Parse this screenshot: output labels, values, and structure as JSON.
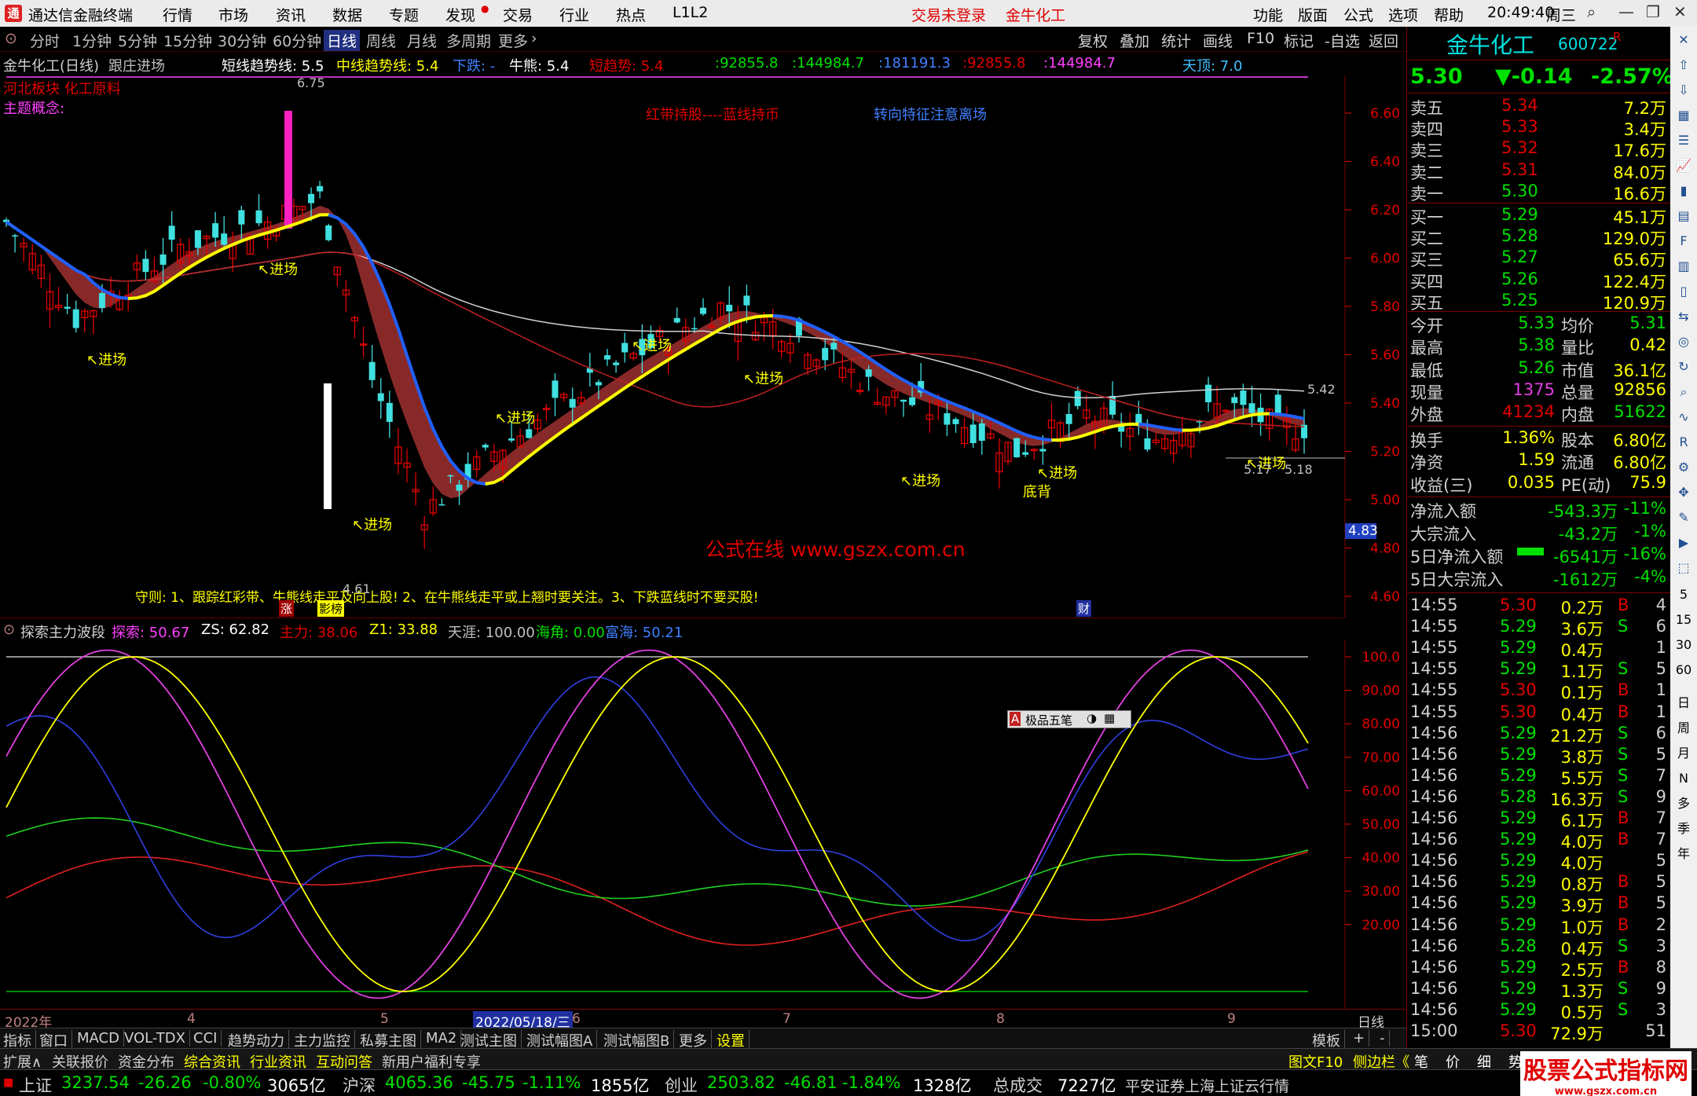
{
  "app": {
    "title": "通达信金融终端",
    "menus": [
      "行情",
      "市场",
      "资讯",
      "数据",
      "专题",
      "发现",
      "交易",
      "行业",
      "热点",
      "L1L2"
    ],
    "login_status": "交易未登录",
    "stock_title": "金牛化工",
    "right_menus": [
      "功能",
      "版面",
      "公式",
      "选项",
      "帮助"
    ],
    "clock": "20:49:40",
    "weekday": "周三"
  },
  "period_bar": {
    "periods": [
      "分时",
      "1分钟",
      "5分钟",
      "15分钟",
      "30分钟",
      "60分钟",
      "日线",
      "周线",
      "月线",
      "多周期",
      "更多"
    ],
    "selected": "日线",
    "right_buttons": [
      "复权",
      "叠加",
      "统计",
      "画线",
      "F10",
      "标记",
      "-自选",
      "返回"
    ]
  },
  "main_chart": {
    "header": {
      "name": "金牛化工(日线)",
      "indicator": "跟庄进场",
      "short_trend": "短线趋势线: 5.5",
      "mid_trend": "中线趋势线: 5.4",
      "down": "下跌: -",
      "bull": "牛熊: 5.4",
      "short_momentum": "短趋势: 5.4",
      "v1": ":92855.8",
      "v2": ":144984.7",
      "v3": ":181191.3",
      "v4": ":92855.8",
      "v5": ":144984.7",
      "top": "天顶: 7.0"
    },
    "concept_1": "河北板块 化工原料",
    "concept_2": "主题概念:",
    "note_red": "红带持股----蓝线持币",
    "note_blue": "转向特征注意离场",
    "watermark": "公式在线  www.gszx.com.cn",
    "rule": "守则: 1、跟踪红彩带、牛熊线走平及向上股! 2、在牛熊线走平或上翘时要关注。3、下跌蓝线时不要买股!",
    "high_label": "6.75",
    "low_label": "4.61",
    "labels": [
      "进场",
      "进场",
      "进场",
      "进场",
      "进场",
      "进场",
      "进场",
      "进场",
      "底背",
      "进场"
    ],
    "label_5_17": "5.17",
    "label_5_18": "5.18",
    "label_5_42": "5.42",
    "badge_zhang": "涨",
    "badge_yingbang": "影榜",
    "badge_cai": "财",
    "price_box": "4.83",
    "y_ticks": [
      "6.60",
      "6.40",
      "6.20",
      "6.00",
      "5.80",
      "5.60",
      "5.40",
      "5.20",
      "5.00",
      "4.80",
      "4.60"
    ]
  },
  "sub_chart": {
    "header": {
      "name": "探索主力波段",
      "explore": "探索: 50.67",
      "zs": "ZS: 62.82",
      "main": "主力: 38.06",
      "z1": "Z1: 33.88",
      "tianya": "天涯: 100.00",
      "haijiao": "海角: 0.00",
      "shanhai": "富海: 50.21"
    },
    "popup": "极品五笔",
    "y_ticks": [
      "100.0",
      "90.00",
      "80.00",
      "70.00",
      "60.00",
      "50.00",
      "40.00",
      "30.00",
      "20.00"
    ]
  },
  "date_axis": {
    "labels": [
      "2022年",
      "4",
      "5",
      "2022/05/18/三",
      "6",
      "7",
      "8",
      "9"
    ],
    "period": "日线"
  },
  "tabbar1": {
    "tabs": [
      "指标",
      "窗口",
      "MACD",
      "VOL-TDX",
      "CCI",
      "趋势动力",
      "主力监控",
      "私募主图",
      "MA2",
      "测试主图",
      "测试幅图A",
      "测试幅图B",
      "更多",
      "设置"
    ],
    "right": "模板",
    "plus": "+",
    "minus": "-"
  },
  "tabbar2": {
    "tabs": [
      "扩展∧",
      "关联报价",
      "资金分布",
      "综合资讯",
      "行业资讯",
      "互动问答",
      "新用户福利专享"
    ],
    "right": "图文F10",
    "right2": "侧边栏《",
    "quote_tabs": [
      "笔",
      "价",
      "细",
      "势"
    ]
  },
  "statusbar": {
    "sh_name": "上证",
    "sh_val": "3237.54",
    "sh_chg": "-26.26",
    "sh_pct": "-0.80%",
    "sh_amt": "3065亿",
    "hs_name": "沪深",
    "hs_val": "4065.36",
    "hs_chg": "-45.75",
    "hs_pct": "-1.11%",
    "hs_amt": "1855亿",
    "cy_name": "创业",
    "cy_val": "2503.82",
    "cy_chg": "-46.81",
    "cy_pct": "-1.84%",
    "cy_amt": "1328亿",
    "total_label": "总成交",
    "total_val": "7227亿",
    "broker": "平安证券上海上证云行情"
  },
  "quote": {
    "name": "金牛化工",
    "code": "600722",
    "flag": "R",
    "price": "5.30",
    "change": "▼-0.14",
    "pct": "-2.57%",
    "asks": [
      {
        "label": "卖五",
        "price": "5.34",
        "vol": "7.2万"
      },
      {
        "label": "卖四",
        "price": "5.33",
        "vol": "3.4万"
      },
      {
        "label": "卖三",
        "price": "5.32",
        "vol": "17.6万"
      },
      {
        "label": "卖二",
        "price": "5.31",
        "vol": "84.0万"
      },
      {
        "label": "卖一",
        "price": "5.30",
        "vol": "16.6万"
      }
    ],
    "bids": [
      {
        "label": "买一",
        "price": "5.29",
        "vol": "45.1万"
      },
      {
        "label": "买二",
        "price": "5.28",
        "vol": "129.0万"
      },
      {
        "label": "买三",
        "price": "5.27",
        "vol": "65.6万"
      },
      {
        "label": "买四",
        "price": "5.26",
        "vol": "122.4万"
      },
      {
        "label": "买五",
        "price": "5.25",
        "vol": "120.9万"
      }
    ],
    "stats": [
      {
        "l1": "今开",
        "v1": "5.33",
        "l2": "均价",
        "v2": "5.31"
      },
      {
        "l1": "最高",
        "v1": "5.38",
        "l2": "量比",
        "v2": "0.42"
      },
      {
        "l1": "最低",
        "v1": "5.26",
        "l2": "市值",
        "v2": "36.1亿"
      },
      {
        "l1": "现量",
        "v1": "1375",
        "l2": "总量",
        "v2": "92856"
      },
      {
        "l1": "外盘",
        "v1": "41234",
        "l2": "内盘",
        "v2": "51622"
      }
    ],
    "stats2": [
      {
        "l1": "换手",
        "v1": "1.36%",
        "l2": "股本",
        "v2": "6.80亿"
      },
      {
        "l1": "净资",
        "v1": "1.59",
        "l2": "流通",
        "v2": "6.80亿"
      },
      {
        "l1": "收益(三)",
        "v1": "0.035",
        "l2": "PE(动)",
        "v2": "75.9"
      }
    ],
    "flows": [
      {
        "label": "净流入额",
        "val": "-543.3万",
        "pct": "-11%"
      },
      {
        "label": "大宗流入",
        "val": "-43.2万",
        "pct": "-1%"
      },
      {
        "label": "5日净流入额",
        "val": "-6541万",
        "pct": "-16%"
      },
      {
        "label": "5日大宗流入",
        "val": "-1612万",
        "pct": "-4%"
      }
    ],
    "ticks": [
      {
        "t": "14:55",
        "p": "5.30",
        "v": "0.2万",
        "d": "B",
        "n": "4"
      },
      {
        "t": "14:55",
        "p": "5.29",
        "v": "3.6万",
        "d": "S",
        "n": "6"
      },
      {
        "t": "14:55",
        "p": "5.29",
        "v": "0.4万",
        "d": "",
        "n": "1"
      },
      {
        "t": "14:55",
        "p": "5.29",
        "v": "1.1万",
        "d": "S",
        "n": "5"
      },
      {
        "t": "14:55",
        "p": "5.30",
        "v": "0.1万",
        "d": "B",
        "n": "1"
      },
      {
        "t": "14:55",
        "p": "5.30",
        "v": "0.4万",
        "d": "B",
        "n": "1"
      },
      {
        "t": "14:56",
        "p": "5.29",
        "v": "21.2万",
        "d": "S",
        "n": "6"
      },
      {
        "t": "14:56",
        "p": "5.29",
        "v": "3.8万",
        "d": "S",
        "n": "5"
      },
      {
        "t": "14:56",
        "p": "5.29",
        "v": "5.5万",
        "d": "S",
        "n": "7"
      },
      {
        "t": "14:56",
        "p": "5.28",
        "v": "16.3万",
        "d": "S",
        "n": "9"
      },
      {
        "t": "14:56",
        "p": "5.29",
        "v": "6.1万",
        "d": "B",
        "n": "7"
      },
      {
        "t": "14:56",
        "p": "5.29",
        "v": "4.0万",
        "d": "B",
        "n": "7"
      },
      {
        "t": "14:56",
        "p": "5.29",
        "v": "4.0万",
        "d": "",
        "n": "5"
      },
      {
        "t": "14:56",
        "p": "5.29",
        "v": "0.8万",
        "d": "B",
        "n": "5"
      },
      {
        "t": "14:56",
        "p": "5.29",
        "v": "3.9万",
        "d": "B",
        "n": "5"
      },
      {
        "t": "14:56",
        "p": "5.29",
        "v": "1.0万",
        "d": "B",
        "n": "2"
      },
      {
        "t": "14:56",
        "p": "5.28",
        "v": "0.4万",
        "d": "S",
        "n": "3"
      },
      {
        "t": "14:56",
        "p": "5.29",
        "v": "2.5万",
        "d": "B",
        "n": "8"
      },
      {
        "t": "14:56",
        "p": "5.29",
        "v": "1.3万",
        "d": "S",
        "n": "9"
      },
      {
        "t": "14:56",
        "p": "5.29",
        "v": "0.5万",
        "d": "S",
        "n": "3"
      },
      {
        "t": "15:00",
        "p": "5.30",
        "v": "72.9万",
        "d": "",
        "n": "51"
      }
    ]
  },
  "side_tools": [
    "日",
    "周",
    "月",
    "N",
    "多",
    "季",
    "年",
    "5",
    "15",
    "30",
    "60"
  ],
  "watermark2": "股票公式指标网",
  "watermark2_url": "www.gszx.com.cn",
  "colors": {
    "up": "#e00000",
    "down": "#00c0c0",
    "yellow": "#ffff00",
    "blue": "#2060ff",
    "band": "#a03030"
  }
}
